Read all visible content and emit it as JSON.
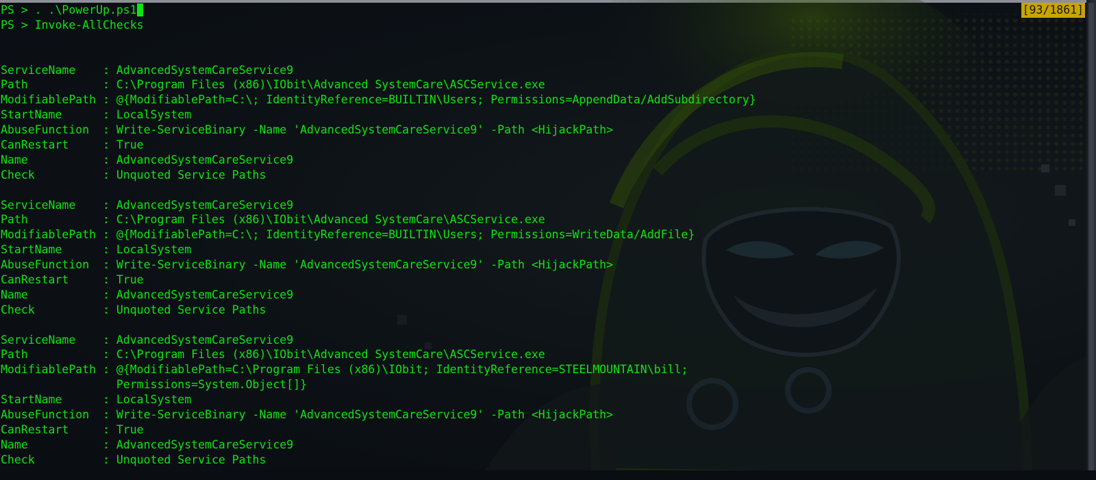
{
  "terminal": {
    "scroll_position": "[93/1861]",
    "lines": [
      "PS > . .\\PowerUp.ps1",
      "PS > Invoke-AllChecks",
      "",
      "",
      "ServiceName    : AdvancedSystemCareService9",
      "Path           : C:\\Program Files (x86)\\IObit\\Advanced SystemCare\\ASCService.exe",
      "ModifiablePath : @{ModifiablePath=C:\\; IdentityReference=BUILTIN\\Users; Permissions=AppendData/AddSubdirectory}",
      "StartName      : LocalSystem",
      "AbuseFunction  : Write-ServiceBinary -Name 'AdvancedSystemCareService9' -Path <HijackPath>",
      "CanRestart     : True",
      "Name           : AdvancedSystemCareService9",
      "Check          : Unquoted Service Paths",
      "",
      "ServiceName    : AdvancedSystemCareService9",
      "Path           : C:\\Program Files (x86)\\IObit\\Advanced SystemCare\\ASCService.exe",
      "ModifiablePath : @{ModifiablePath=C:\\; IdentityReference=BUILTIN\\Users; Permissions=WriteData/AddFile}",
      "StartName      : LocalSystem",
      "AbuseFunction  : Write-ServiceBinary -Name 'AdvancedSystemCareService9' -Path <HijackPath>",
      "CanRestart     : True",
      "Name           : AdvancedSystemCareService9",
      "Check          : Unquoted Service Paths",
      "",
      "ServiceName    : AdvancedSystemCareService9",
      "Path           : C:\\Program Files (x86)\\IObit\\Advanced SystemCare\\ASCService.exe",
      "ModifiablePath : @{ModifiablePath=C:\\Program Files (x86)\\IObit; IdentityReference=STEELMOUNTAIN\\bill;",
      "                 Permissions=System.Object[]}",
      "StartName      : LocalSystem",
      "AbuseFunction  : Write-ServiceBinary -Name 'AdvancedSystemCareService9' -Path <HijackPath>",
      "CanRestart     : True",
      "Name           : AdvancedSystemCareService9",
      "Check          : Unquoted Service Paths"
    ]
  },
  "colors": {
    "text": "#12e312",
    "background": "#0b0f14",
    "indicator_bg": "#c9a400",
    "indicator_text": "#1a1a1a"
  },
  "icons": {
    "wallpaper": "hooded-hacker-mask-art"
  }
}
